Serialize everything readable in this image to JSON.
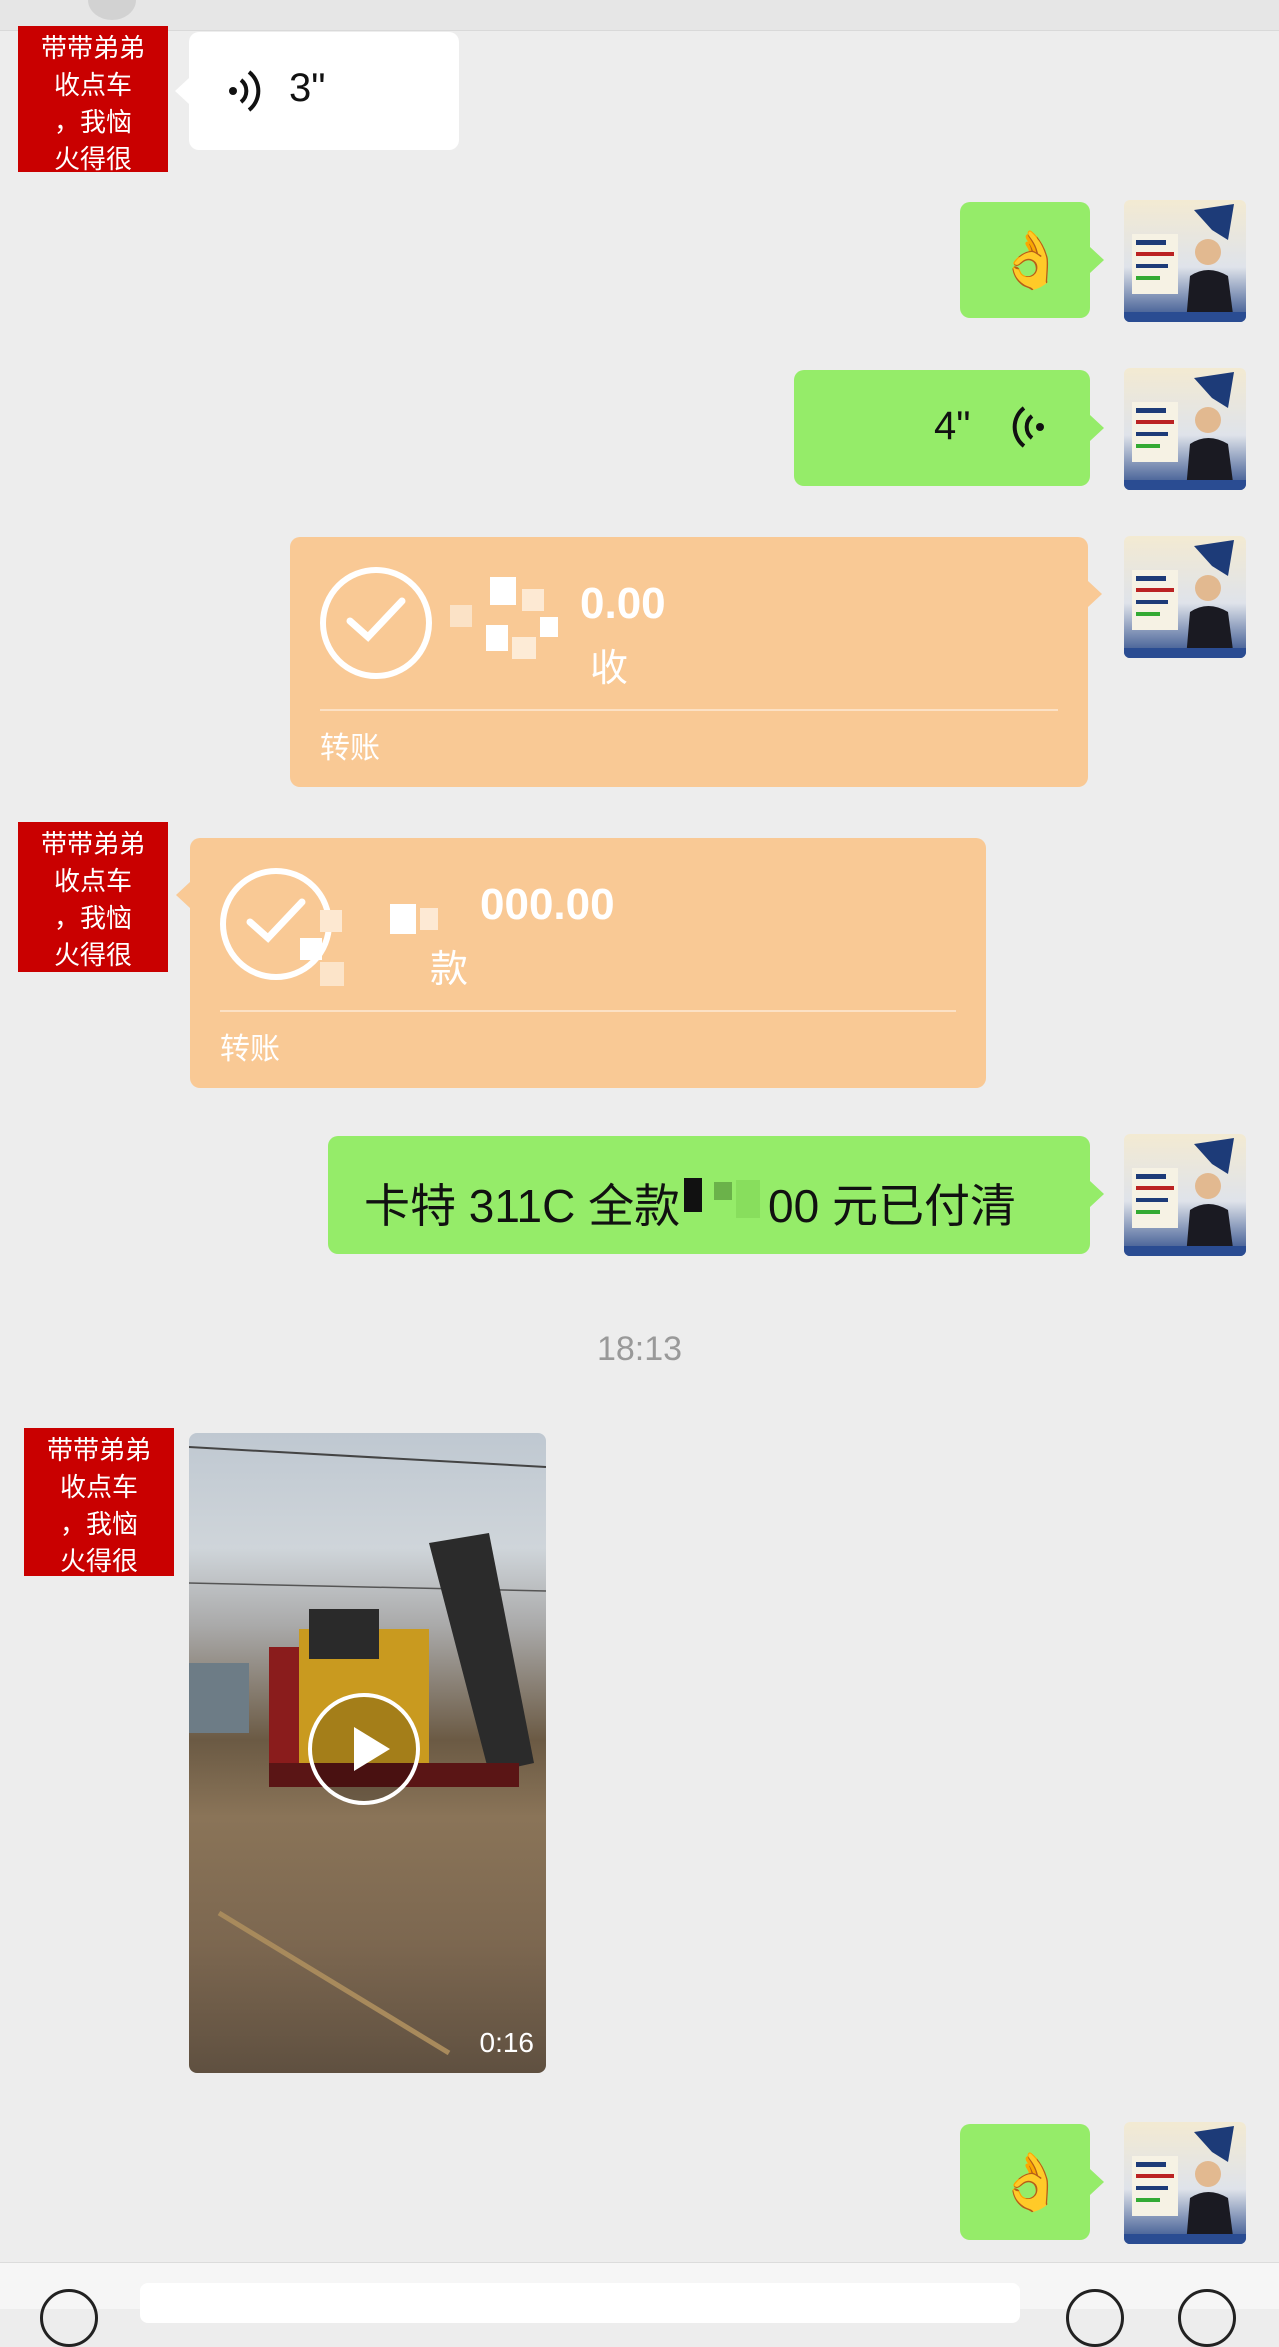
{
  "contact": {
    "name_lines": [
      "带带弟弟",
      "收点车",
      "，我恼",
      "火得很"
    ]
  },
  "messages": {
    "voice_in": {
      "duration": "3\"",
      "wave_icon": "voice-wave-icon"
    },
    "emoji_1": {
      "emoji": "👌",
      "icon": "ok-hand-icon"
    },
    "voice_out": {
      "duration": "4\"",
      "wave_icon": "voice-wave-icon"
    },
    "transfer_out": {
      "amount": "0.00",
      "status": "收",
      "label": "转账",
      "icon": "check-circle-icon"
    },
    "transfer_in": {
      "amount": "000.00",
      "status": "款",
      "label": "转账",
      "icon": "check-circle-icon"
    },
    "text_out": {
      "text_a": "卡特 311C 全款",
      "text_b": "00 元已付清"
    },
    "timestamp": "18:13",
    "video_in": {
      "duration": "0:16",
      "icon": "play-icon"
    },
    "emoji_2": {
      "emoji": "👌",
      "icon": "ok-hand-icon"
    }
  },
  "colors": {
    "background": "#ededed",
    "bubble_green": "#95ec69",
    "bubble_white": "#ffffff",
    "bubble_transfer": "#f9c995",
    "avatar_red": "#c90000"
  }
}
